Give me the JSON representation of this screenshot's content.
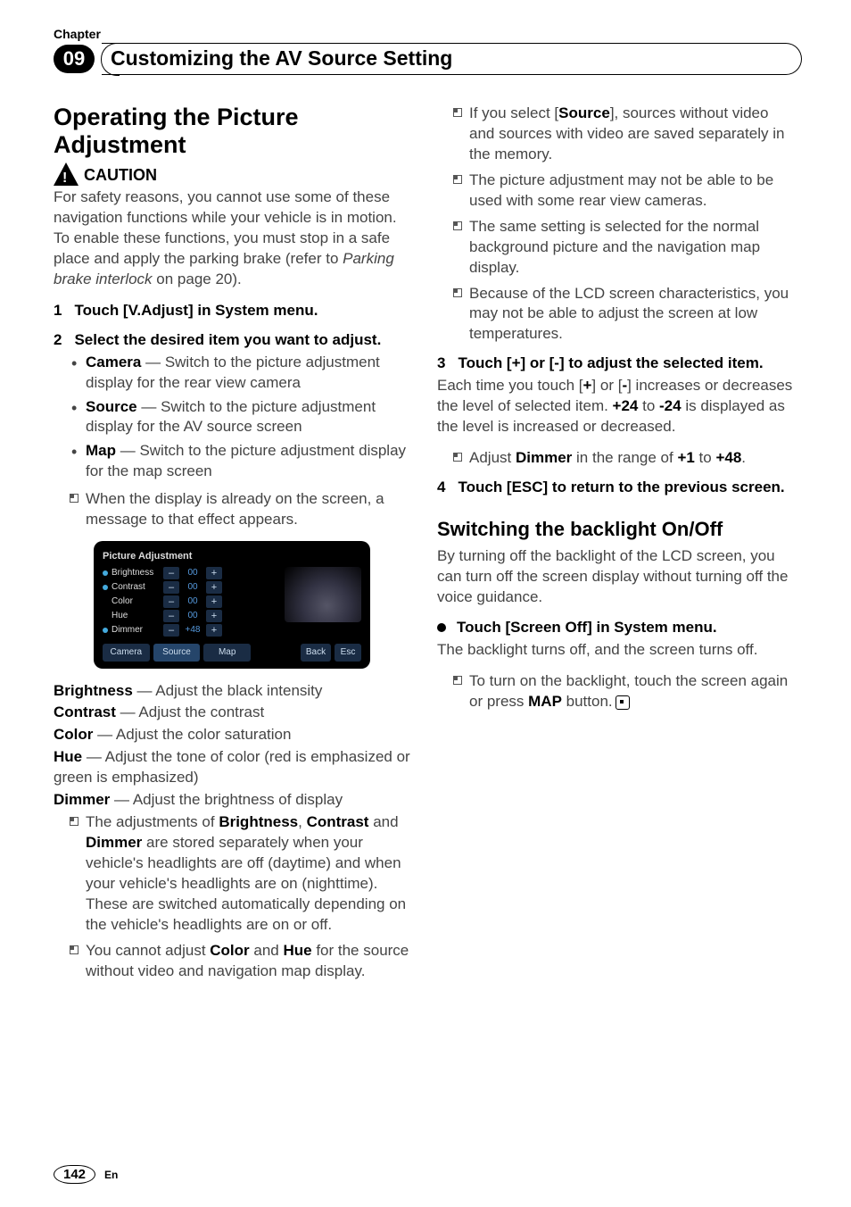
{
  "header": {
    "chapter_label": "Chapter",
    "chapter_num": "09",
    "page_title": "Customizing the AV Source Setting"
  },
  "left": {
    "h1": "Operating the Picture Adjustment",
    "caution_label": "CAUTION",
    "caution_body_1": "For safety reasons, you cannot use some of these navigation functions while your vehicle is in motion. To enable these functions, you must stop in a safe place and apply the parking brake (refer to ",
    "caution_body_ref": "Parking brake interlock",
    "caution_body_2": " on page 20).",
    "step1": "Touch [V.Adjust] in System menu.",
    "step2": "Select the desired item you want to adjust.",
    "bullets": {
      "camera_b": "Camera",
      "camera_t": " — Switch to the picture adjustment display for the rear view camera",
      "source_b": "Source",
      "source_t": " — Switch to the picture adjustment display for the AV source screen",
      "map_b": "Map",
      "map_t": " — Switch to the picture adjustment display for the map screen"
    },
    "note_already": "When the display is already on the screen, a message to that effect appears.",
    "figure": {
      "title": "Picture Adjustment",
      "items": [
        {
          "label": "Brightness",
          "val": "00",
          "dot": true
        },
        {
          "label": "Contrast",
          "val": "00",
          "dot": true
        },
        {
          "label": "Color",
          "val": "00",
          "dot": false
        },
        {
          "label": "Hue",
          "val": "00",
          "dot": false
        },
        {
          "label": "Dimmer",
          "val": "+48",
          "dot": true
        }
      ],
      "tabs": {
        "camera": "Camera",
        "source": "Source",
        "map": "Map",
        "back": "Back",
        "esc": "Esc"
      }
    },
    "defs": {
      "brightness_b": "Brightness",
      "brightness_t": " — Adjust the black intensity",
      "contrast_b": "Contrast",
      "contrast_t": " — Adjust the contrast",
      "color_b": "Color",
      "color_t": " — Adjust the color saturation",
      "hue_b": "Hue",
      "hue_t": " — Adjust the tone of color (red is emphasized or green is emphasized)",
      "dimmer_b": "Dimmer",
      "dimmer_t": " — Adjust the brightness of display"
    },
    "notes2": {
      "a_pre": "The adjustments of ",
      "a_b1": "Brightness",
      "a_mid1": ", ",
      "a_b2": "Contrast",
      "a_mid2": " and ",
      "a_b3": "Dimmer",
      "a_post": " are stored separately when your vehicle's headlights are off (daytime) and when your vehicle's headlights are on (nighttime). These are switched automatically depending on the vehicle's headlights are on or off.",
      "b_pre": "You cannot adjust ",
      "b_b1": "Color",
      "b_mid": " and ",
      "b_b2": "Hue",
      "b_post": " for the source without video and navigation map display."
    }
  },
  "right": {
    "notes_top": {
      "a_pre": "If you select [",
      "a_b": "Source",
      "a_post": "], sources without video and sources with video are saved separately in the memory.",
      "b": "The picture adjustment may not be able to be used with some rear view cameras.",
      "c": "The same setting is selected for the normal background picture and the navigation map display.",
      "d": "Because of the LCD screen characteristics, you may not be able to adjust the screen at low temperatures."
    },
    "step3": "Touch [+] or [-] to adjust the selected item.",
    "step3_body_pre": "Each time you touch [",
    "step3_body_plus": "+",
    "step3_body_mid1": "] or [",
    "step3_body_minus": "-",
    "step3_body_mid2": "] increases or decreases the level of selected item. ",
    "step3_body_p24": "+24",
    "step3_body_to": " to ",
    "step3_body_m24": "-24",
    "step3_body_post": " is displayed as the level is increased or decreased.",
    "step3_note_pre": "Adjust ",
    "step3_note_b": "Dimmer",
    "step3_note_mid": " in the range of ",
    "step3_note_p1": "+1",
    "step3_note_to": " to ",
    "step3_note_p48": "+48",
    "step3_note_end": ".",
    "step4": "Touch [ESC] to return to the previous screen.",
    "h2": "Switching the backlight On/Off",
    "h2_body": "By turning off the backlight of the LCD screen, you can turn off the screen display without turning off the voice guidance.",
    "bullet_action": "Touch [Screen Off] in System menu.",
    "action_body": "The backlight turns off, and the screen turns off.",
    "action_note_pre": "To turn on the backlight, touch the screen again or press ",
    "action_note_b": "MAP",
    "action_note_post": " button."
  },
  "footer": {
    "page": "142",
    "lang": "En"
  }
}
